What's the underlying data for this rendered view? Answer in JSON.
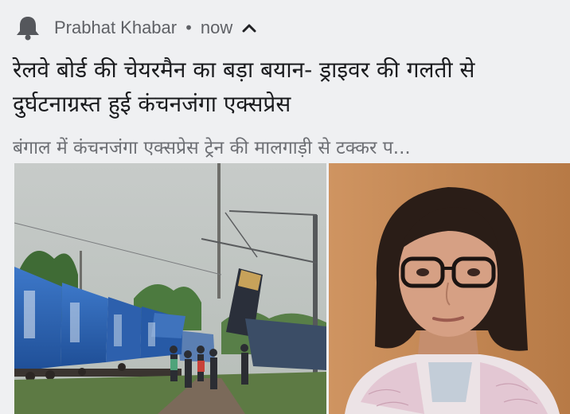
{
  "notification": {
    "app_icon": "bell-icon",
    "source": "Prabhat Khabar",
    "separator": "•",
    "time": "now",
    "collapse_icon": "chevron-up-icon",
    "title": "रेलवे बोर्ड की चेयरमैन का बड़ा बयान- ड्राइवर की गलती से दुर्घटनाग्रस्त हुई कंचनजंगा एक्सप्रेस",
    "snippet": "बंगाल में कंचनजंगा एक्सप्रेस ट्रेन की मालगाड़ी से टक्कर प..."
  },
  "images": {
    "left": "train-accident-photo",
    "right": "railway-board-chairperson-portrait"
  },
  "colors": {
    "background": "#eff0f2",
    "text_primary": "#1b1c1f",
    "text_secondary": "#6d6f74",
    "wagon_blue": "#2a63b8",
    "portrait_bg": "#c98a56"
  }
}
